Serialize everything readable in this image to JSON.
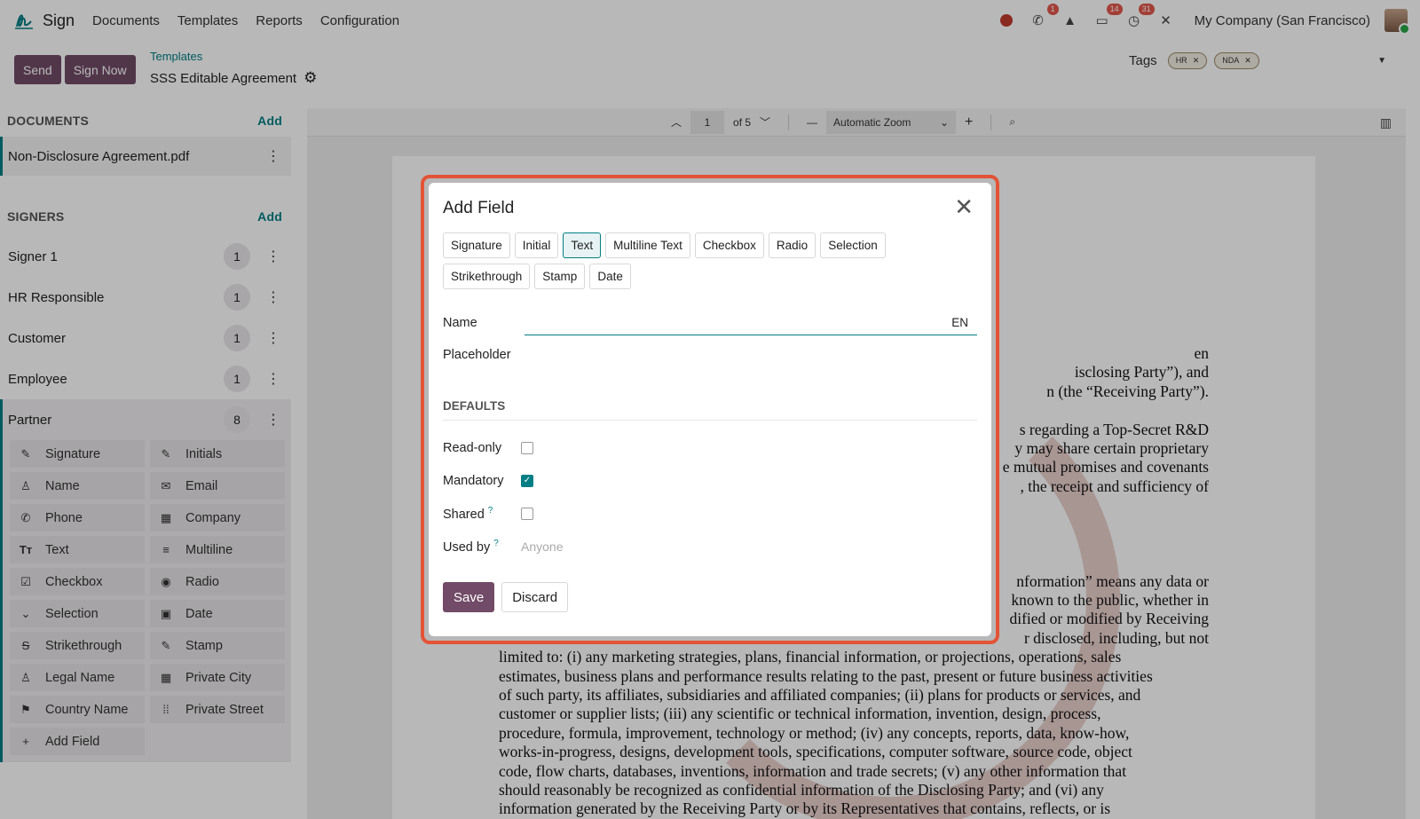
{
  "navbar": {
    "app_name": "Sign",
    "menu": [
      "Documents",
      "Templates",
      "Reports",
      "Configuration"
    ],
    "badges": {
      "phone": "1",
      "messages": "14",
      "activities": "31"
    },
    "company": "My Company (San Francisco)"
  },
  "control_panel": {
    "send_label": "Send",
    "sign_now_label": "Sign Now",
    "breadcrumb_parent": "Templates",
    "breadcrumb_current": "SSS Editable Agreement",
    "tags_label": "Tags",
    "tags": [
      "HR",
      "NDA"
    ]
  },
  "sidebar": {
    "documents_title": "DOCUMENTS",
    "documents_add": "Add",
    "document_name": "Non-Disclosure Agreement.pdf",
    "signers_title": "SIGNERS",
    "signers_add": "Add",
    "signers": [
      {
        "name": "Signer 1",
        "count": "1"
      },
      {
        "name": "HR Responsible",
        "count": "1"
      },
      {
        "name": "Customer",
        "count": "1"
      },
      {
        "name": "Employee",
        "count": "1"
      }
    ],
    "partner": {
      "name": "Partner",
      "count": "8"
    },
    "fields": [
      {
        "label": "Signature",
        "icon": "pen-square-icon"
      },
      {
        "label": "Initials",
        "icon": "pen-square-icon"
      },
      {
        "label": "Name",
        "icon": "user-icon"
      },
      {
        "label": "Email",
        "icon": "envelope-icon"
      },
      {
        "label": "Phone",
        "icon": "phone-icon"
      },
      {
        "label": "Company",
        "icon": "building-icon"
      },
      {
        "label": "Text",
        "icon": "text-icon"
      },
      {
        "label": "Multiline",
        "icon": "lines-icon"
      },
      {
        "label": "Checkbox",
        "icon": "checkbox-icon"
      },
      {
        "label": "Radio",
        "icon": "radio-icon"
      },
      {
        "label": "Selection",
        "icon": "chevron-down-icon"
      },
      {
        "label": "Date",
        "icon": "calendar-icon"
      },
      {
        "label": "Strikethrough",
        "icon": "strikethrough-icon"
      },
      {
        "label": "Stamp",
        "icon": "pen-square-icon"
      },
      {
        "label": "Legal Name",
        "icon": "user-icon"
      },
      {
        "label": "Private City",
        "icon": "building-icon"
      },
      {
        "label": "Country Name",
        "icon": "flag-icon"
      },
      {
        "label": "Private Street",
        "icon": "road-icon"
      },
      {
        "label": "Add Field",
        "icon": "plus-icon"
      }
    ]
  },
  "viewer": {
    "page_current": "1",
    "page_total": "of 5",
    "zoom": "Automatic Zoom",
    "document_lines": [
      "en",
      "isclosing Party”), and",
      "n (the “Receiving Party”).",
      "",
      "s regarding a Top-Secret R&D",
      "y may share certain proprietary",
      "e mutual promises and covenants",
      ", the receipt and sufficiency of",
      "",
      "",
      "",
      "",
      "nformation” means any data or",
      "known to the public, whether in",
      "dified or modified by Receiving",
      "r disclosed, including, but not",
      "limited to: (i) any marketing strategies, plans, financial information, or projections, operations, sales",
      "estimates, business plans and performance results relating to the past, present or future business activities",
      "of such party, its affiliates, subsidiaries and affiliated companies; (ii) plans for products or services, and",
      "customer or supplier lists; (iii) any scientific or technical information, invention, design, process,",
      "procedure, formula, improvement, technology or method; (iv) any concepts, reports, data, know-how,",
      "works-in-progress, designs, development tools, specifications, computer software, source code, object",
      "code, flow charts, databases, inventions, information and trade secrets; (v) any other information that",
      "should reasonably be recognized as confidential information of the Disclosing Party; and (vi) any",
      "information generated by the Receiving Party or by its Representatives that contains, reflects, or is"
    ]
  },
  "modal": {
    "title": "Add Field",
    "types": [
      "Signature",
      "Initial",
      "Text",
      "Multiline Text",
      "Checkbox",
      "Radio",
      "Selection",
      "Strikethrough",
      "Stamp",
      "Date"
    ],
    "active_type": "Text",
    "name_label": "Name",
    "name_lang": "EN",
    "placeholder_label": "Placeholder",
    "defaults_title": "DEFAULTS",
    "readonly_label": "Read-only",
    "readonly_checked": false,
    "mandatory_label": "Mandatory",
    "mandatory_checked": true,
    "shared_label": "Shared",
    "shared_checked": false,
    "used_by_label": "Used by",
    "used_by_placeholder": "Anyone",
    "help_mark": "?",
    "save_label": "Save",
    "discard_label": "Discard"
  },
  "colors": {
    "brand": "#714B67",
    "accent": "#017e84",
    "highlight": "#e35336"
  }
}
